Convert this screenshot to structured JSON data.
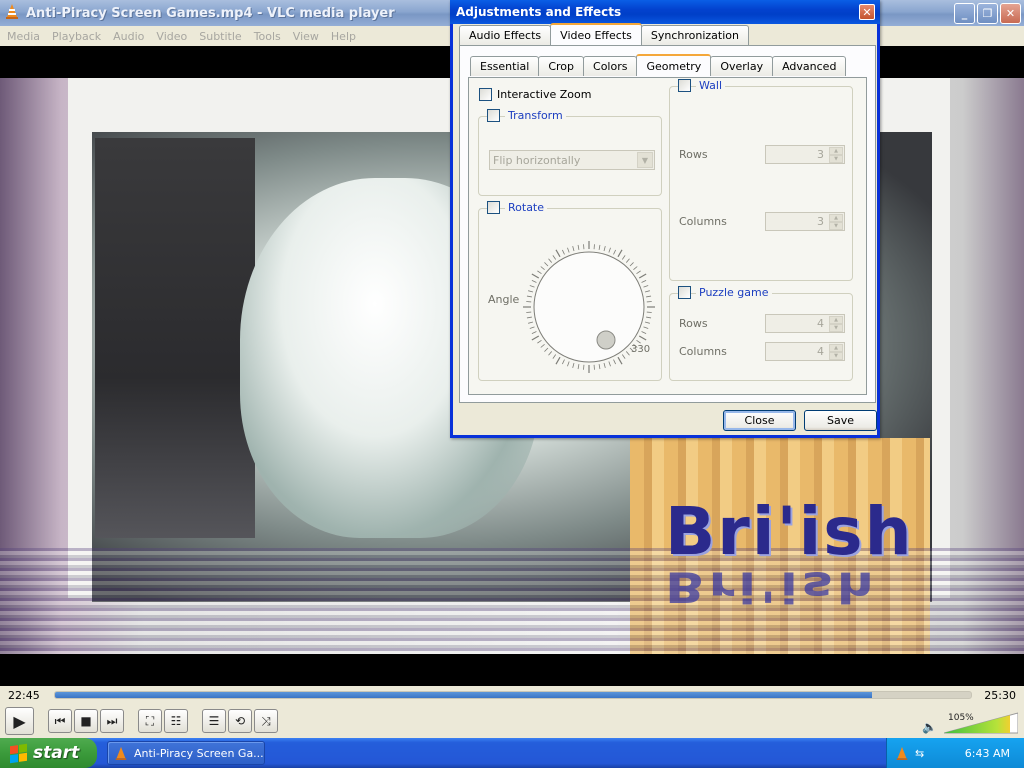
{
  "vlc": {
    "title": "Anti-Piracy Screen Games.mp4 - VLC media player",
    "menu": [
      "Media",
      "Playback",
      "Audio",
      "Video",
      "Subtitle",
      "Tools",
      "View",
      "Help"
    ],
    "video_text": "Bri'ish",
    "elapsed": "22:45",
    "total": "25:30",
    "progress_fraction": 0.892,
    "volume": "105%"
  },
  "dialog": {
    "title": "Adjustments and Effects",
    "tabs": [
      "Audio Effects",
      "Video Effects",
      "Synchronization"
    ],
    "active_tab": "Video Effects",
    "subtabs": [
      "Essential",
      "Crop",
      "Colors",
      "Geometry",
      "Overlay",
      "Advanced"
    ],
    "active_subtab": "Geometry",
    "interactive_zoom": "Interactive Zoom",
    "transform": {
      "label": "Transform",
      "select_value": "Flip horizontally"
    },
    "rotate": {
      "label": "Rotate",
      "angle_label": "Angle",
      "angle_value": "330"
    },
    "wall": {
      "label": "Wall",
      "rows_label": "Rows",
      "rows": "3",
      "columns_label": "Columns",
      "columns": "3"
    },
    "puzzle": {
      "label": "Puzzle game",
      "rows_label": "Rows",
      "rows": "4",
      "columns_label": "Columns",
      "columns": "4"
    },
    "close": "Close",
    "save": "Save"
  },
  "taskbar": {
    "start": "start",
    "task": "Anti-Piracy Screen Ga...",
    "clock": "6:43 AM"
  },
  "colors": {
    "xp_blue": "#0831d9",
    "seek_fill": "#3a74c5",
    "vlc_orange": "#f08a1c"
  }
}
